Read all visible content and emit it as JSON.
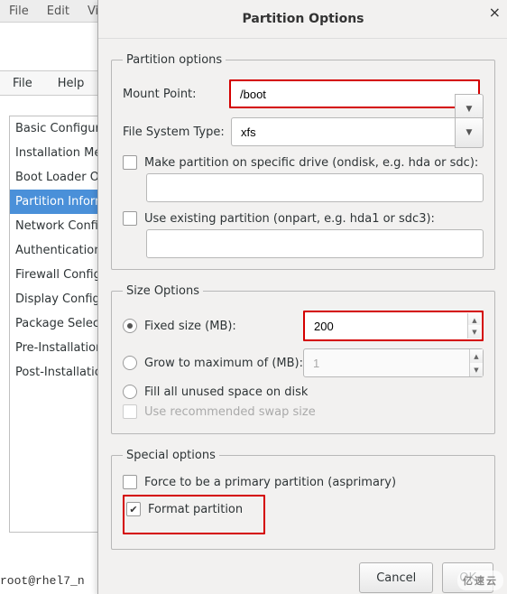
{
  "menubar": {
    "file": "File",
    "edit": "Edit",
    "view": "View"
  },
  "app_menubar": {
    "file": "File",
    "help": "Help"
  },
  "sidebar": {
    "items": [
      {
        "label": "Basic Configuration"
      },
      {
        "label": "Installation Method"
      },
      {
        "label": "Boot Loader Options"
      },
      {
        "label": "Partition Information"
      },
      {
        "label": "Network Configuration"
      },
      {
        "label": "Authentication"
      },
      {
        "label": "Firewall Configuration"
      },
      {
        "label": "Display Configuration"
      },
      {
        "label": "Package Selection"
      },
      {
        "label": "Pre-Installation Script"
      },
      {
        "label": "Post-Installation Script"
      }
    ],
    "selected_index": 3
  },
  "terminal": {
    "line": "root@rhel7_n"
  },
  "dialog": {
    "title": "Partition Options",
    "close": "×",
    "po": {
      "legend": "Partition options",
      "mount_label": "Mount Point:",
      "mount_value": "/boot",
      "fs_label": "File System Type:",
      "fs_value": "xfs",
      "ondisk_label": "Make partition on specific drive (ondisk, e.g. hda or sdc):",
      "ondisk_value": "",
      "onpart_label": "Use existing partition (onpart, e.g. hda1 or sdc3):",
      "onpart_value": ""
    },
    "size": {
      "legend": "Size Options",
      "fixed_label": "Fixed size (MB):",
      "fixed_value": "200",
      "grow_label": "Grow to maximum of (MB):",
      "grow_value": "1",
      "fill_label": "Fill all unused space on disk",
      "swap_label": "Use recommended swap size"
    },
    "special": {
      "legend": "Special options",
      "primary_label": "Force to be a primary partition (asprimary)",
      "format_label": "Format partition"
    },
    "buttons": {
      "cancel": "Cancel",
      "ok": "OK"
    }
  },
  "watermark": "亿速云"
}
